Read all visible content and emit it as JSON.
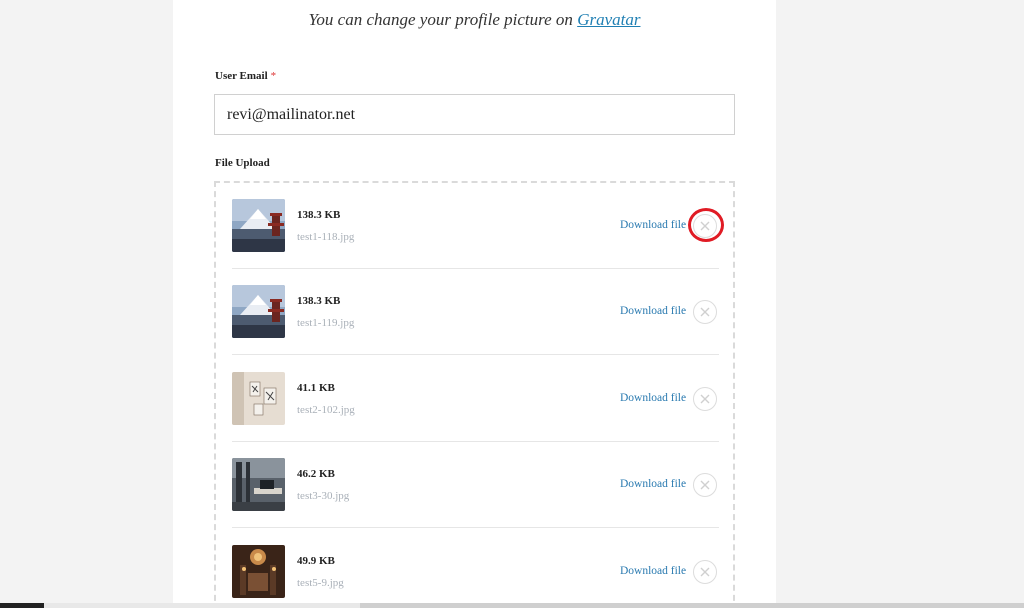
{
  "header": {
    "gravatar_text": "You can change your profile picture on",
    "gravatar_link": "Gravatar"
  },
  "email": {
    "label": "User Email",
    "required_mark": "*",
    "value": "revi@mailinator.net"
  },
  "upload": {
    "label": "File Upload",
    "download_label": "Download file",
    "files": [
      {
        "size": "138.3 KB",
        "name": "test1-118.jpg",
        "thumb": "mountain-pagoda"
      },
      {
        "size": "138.3 KB",
        "name": "test1-119.jpg",
        "thumb": "mountain-pagoda"
      },
      {
        "size": "41.1 KB",
        "name": "test2-102.jpg",
        "thumb": "art-wall"
      },
      {
        "size": "46.2 KB",
        "name": "test3-30.jpg",
        "thumb": "office-desk"
      },
      {
        "size": "49.9 KB",
        "name": "test5-9.jpg",
        "thumb": "lit-interior"
      }
    ]
  },
  "annotation": {
    "color": "#e01b24",
    "target": "remove-file-1"
  },
  "colors": {
    "link": "#1f7fb3",
    "download": "#2a7ab0",
    "muted": "#a9b0b8"
  }
}
